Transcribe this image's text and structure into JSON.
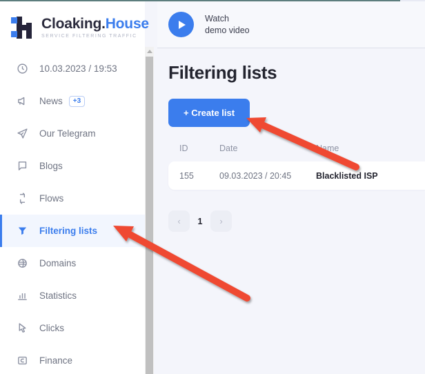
{
  "brand": {
    "name_main": "Cloaking.",
    "name_accent": "House",
    "tagline": "SERVICE FILTERING TRAFFIC"
  },
  "sidebar": {
    "items": [
      {
        "label": "10.03.2023 / 19:53",
        "icon": "clock-icon",
        "active": false,
        "badge": null
      },
      {
        "label": "News",
        "icon": "megaphone-icon",
        "active": false,
        "badge": "+3"
      },
      {
        "label": "Our Telegram",
        "icon": "paper-plane-icon",
        "active": false,
        "badge": null
      },
      {
        "label": "Blogs",
        "icon": "speech-bubble-icon",
        "active": false,
        "badge": null
      },
      {
        "label": "Flows",
        "icon": "swap-arrows-icon",
        "active": false,
        "badge": null
      },
      {
        "label": "Filtering lists",
        "icon": "funnel-icon",
        "active": true,
        "badge": null
      },
      {
        "label": "Domains",
        "icon": "globe-icon",
        "active": false,
        "badge": null
      },
      {
        "label": "Statistics",
        "icon": "bar-chart-icon",
        "active": false,
        "badge": null
      },
      {
        "label": "Clicks",
        "icon": "cursor-icon",
        "active": false,
        "badge": null
      },
      {
        "label": "Finance",
        "icon": "card-icon",
        "active": false,
        "badge": null
      }
    ]
  },
  "topbar": {
    "watch_line1": "Watch",
    "watch_line2": "demo video",
    "play_icon": "play-icon"
  },
  "main": {
    "page_title": "Filtering lists",
    "create_button": "+ Create list",
    "table": {
      "headers": [
        "ID",
        "Date",
        "Name"
      ],
      "rows": [
        {
          "id": "155",
          "date": "09.03.2023 / 20:45",
          "name": "Blacklisted ISP"
        }
      ]
    },
    "pagination": {
      "prev_icon": "chevron-left-icon",
      "next_icon": "chevron-right-icon",
      "current_page": "1"
    }
  },
  "colors": {
    "accent_blue": "#3b7ded",
    "annotation_red": "#ef4a32",
    "page_bg": "#f4f5fb",
    "active_nav_bg": "#f2f6fe"
  }
}
